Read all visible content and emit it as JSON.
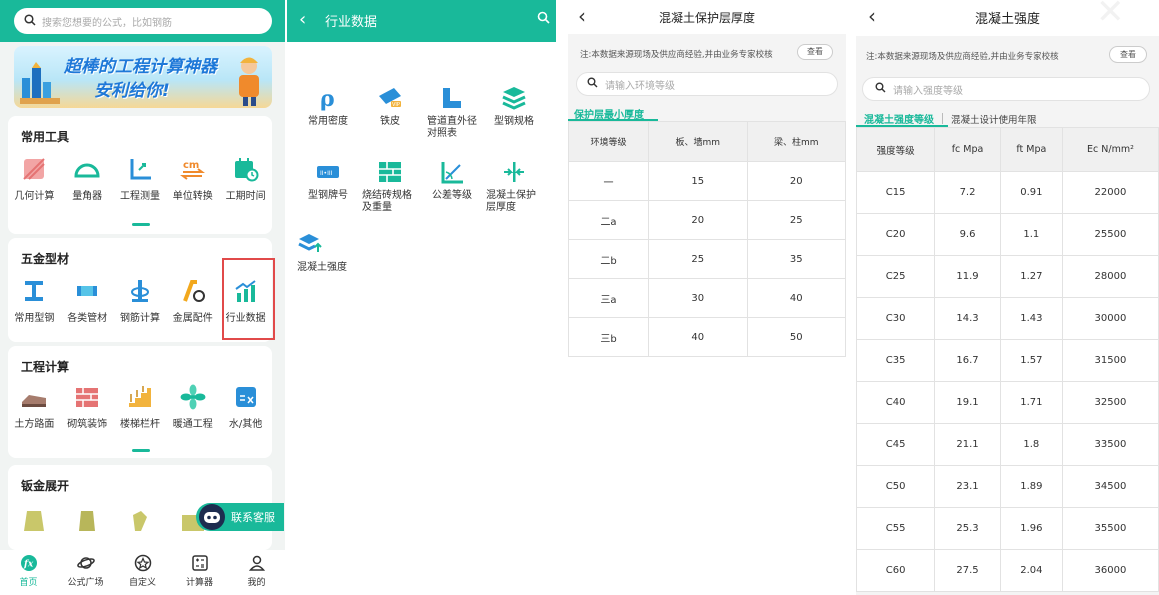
{
  "colors": {
    "accent": "#19b99a",
    "highlight_box": "#e14a4a"
  },
  "p1": {
    "search_placeholder": "搜索您想要的公式，比如钢筋",
    "banner_line1": "超棒的工程计算神器",
    "banner_line2": "安利给你!",
    "sections": [
      {
        "title": "常用工具",
        "items": [
          {
            "label": "几何计算",
            "icon": "cube-icon"
          },
          {
            "label": "量角器",
            "icon": "protractor-icon"
          },
          {
            "label": "工程测量",
            "icon": "axis-measure-icon"
          },
          {
            "label": "单位转换",
            "icon": "unit-convert-icon"
          },
          {
            "label": "工期时间",
            "icon": "calendar-icon"
          }
        ]
      },
      {
        "title": "五金型材",
        "items": [
          {
            "label": "常用型钢",
            "icon": "i-beam-icon"
          },
          {
            "label": "各类管材",
            "icon": "pipe-icon"
          },
          {
            "label": "钢筋计算",
            "icon": "rebar-icon"
          },
          {
            "label": "金属配件",
            "icon": "metal-fitting-icon"
          },
          {
            "label": "行业数据",
            "icon": "industry-data-icon"
          }
        ]
      },
      {
        "title": "工程计算",
        "items": [
          {
            "label": "土方路面",
            "icon": "earthwork-icon"
          },
          {
            "label": "砌筑装饰",
            "icon": "brick-icon"
          },
          {
            "label": "楼梯栏杆",
            "icon": "stairs-icon"
          },
          {
            "label": "暖通工程",
            "icon": "fan-icon"
          },
          {
            "label": "水/其他",
            "icon": "water-other-icon"
          }
        ]
      },
      {
        "title": "钣金展开",
        "items": []
      }
    ],
    "customer_service": "联系客服",
    "tabs": [
      {
        "label": "首页",
        "icon": "home-fx-icon"
      },
      {
        "label": "公式广场",
        "icon": "planet-icon"
      },
      {
        "label": "自定义",
        "icon": "custom-icon"
      },
      {
        "label": "计算器",
        "icon": "calculator-icon"
      },
      {
        "label": "我的",
        "icon": "user-icon"
      }
    ]
  },
  "p2": {
    "title": "行业数据",
    "items": [
      {
        "label": "常用密度",
        "icon": "density-icon"
      },
      {
        "label": "铁皮",
        "icon": "sheet-metal-icon"
      },
      {
        "label": "管道直外径对照表",
        "icon": "pipe-diameter-icon"
      },
      {
        "label": "型钢规格",
        "icon": "steel-spec-icon"
      },
      {
        "label": "型钢牌号",
        "icon": "steel-grade-icon"
      },
      {
        "label": "烧结砖规格及重量",
        "icon": "brick-spec-icon"
      },
      {
        "label": "公差等级",
        "icon": "tolerance-icon"
      },
      {
        "label": "混凝土保护层厚度",
        "icon": "concrete-cover-icon"
      },
      {
        "label": "混凝土强度",
        "icon": "concrete-strength-icon"
      }
    ]
  },
  "p3": {
    "title": "混凝土保护层厚度",
    "note": "注:本数据来源现场及供应商经验,并由业务专家校核",
    "view_btn": "查看",
    "search_placeholder": "请输入环境等级",
    "subtab": "保护层最小厚度",
    "headers": [
      "环境等级",
      "板、墙mm",
      "梁、柱mm"
    ],
    "rows": [
      [
        "一",
        "15",
        "20"
      ],
      [
        "二a",
        "20",
        "25"
      ],
      [
        "二b",
        "25",
        "35"
      ],
      [
        "三a",
        "30",
        "40"
      ],
      [
        "三b",
        "40",
        "50"
      ]
    ]
  },
  "p4": {
    "title": "混凝土强度",
    "note": "注:本数据来源现场及供应商经验,并由业务专家校核",
    "view_btn": "查看",
    "search_placeholder": "请输入强度等级",
    "tab_active": "混凝土强度等级",
    "tab_inactive": "混凝土设计使用年限",
    "headers": [
      "强度等级",
      "fc Mpa",
      "ft Mpa",
      "Ec N/mm²"
    ],
    "rows": [
      [
        "C15",
        "7.2",
        "0.91",
        "22000"
      ],
      [
        "C20",
        "9.6",
        "1.1",
        "25500"
      ],
      [
        "C25",
        "11.9",
        "1.27",
        "28000"
      ],
      [
        "C30",
        "14.3",
        "1.43",
        "30000"
      ],
      [
        "C35",
        "16.7",
        "1.57",
        "31500"
      ],
      [
        "C40",
        "19.1",
        "1.71",
        "32500"
      ],
      [
        "C45",
        "21.1",
        "1.8",
        "33500"
      ],
      [
        "C50",
        "23.1",
        "1.89",
        "34500"
      ],
      [
        "C55",
        "25.3",
        "1.96",
        "35500"
      ],
      [
        "C60",
        "27.5",
        "2.04",
        "36000"
      ]
    ]
  }
}
